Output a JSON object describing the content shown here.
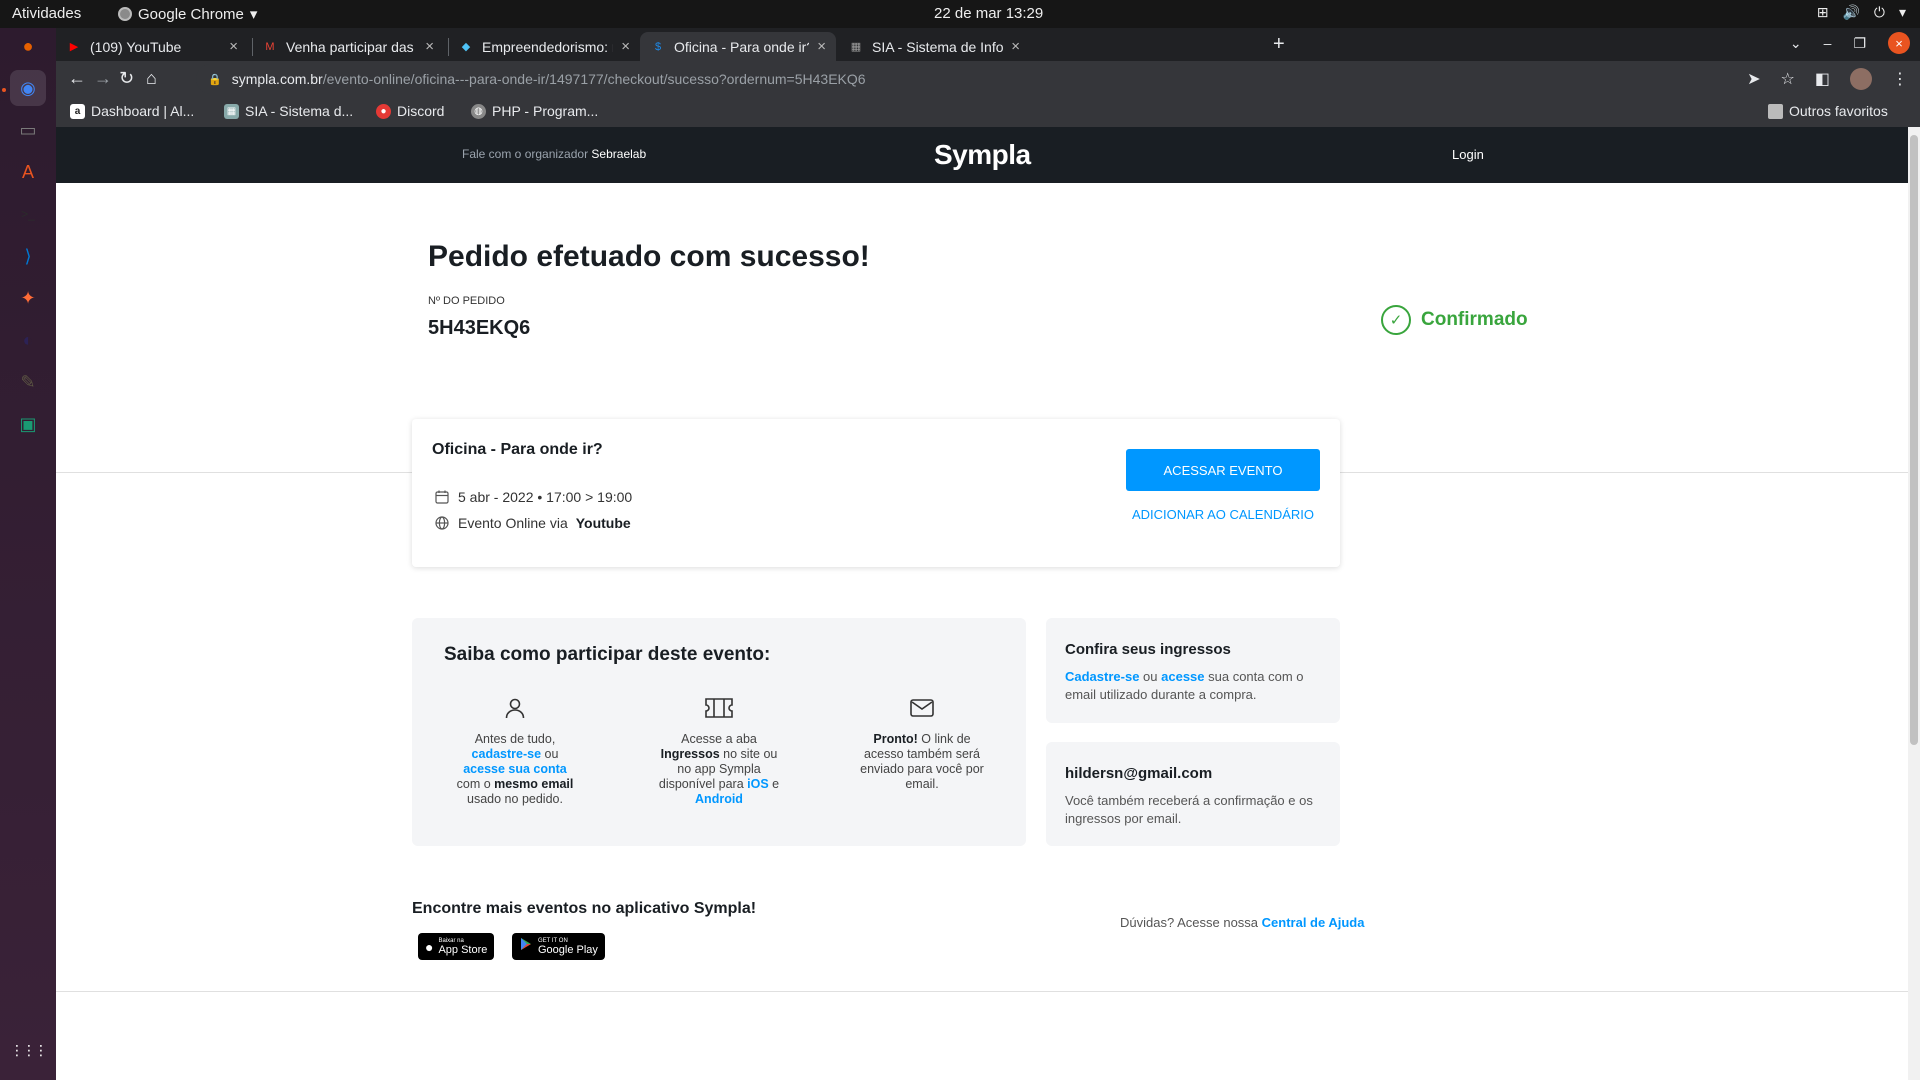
{
  "os": {
    "activities": "Atividades",
    "app_name": "Google Chrome",
    "app_caret": "▾",
    "clock": "22 de mar  13:29",
    "tray_network": "⊞",
    "tray_volume": "🔊",
    "tray_power": "⏻",
    "tray_caret": "▾"
  },
  "dock": {
    "items": [
      {
        "name": "firefox",
        "glyph": "●",
        "color": "#e66000"
      },
      {
        "name": "chrome",
        "glyph": "◉",
        "color": "#4285f4"
      },
      {
        "name": "files",
        "glyph": "▭",
        "color": "#7a7a7a"
      },
      {
        "name": "software",
        "glyph": "A",
        "color": "#e95420"
      },
      {
        "name": "terminal",
        "glyph": ">_",
        "color": "#2b2b2b"
      },
      {
        "name": "vscode",
        "glyph": "⟩",
        "color": "#0078d4"
      },
      {
        "name": "postman",
        "glyph": "✦",
        "color": "#ff6c37"
      },
      {
        "name": "eclipse",
        "glyph": "◐",
        "color": "#2c2255"
      },
      {
        "name": "gimp",
        "glyph": "✎",
        "color": "#5c5543"
      },
      {
        "name": "android",
        "glyph": "▣",
        "color": "#1a9b73"
      }
    ],
    "apps_grid": "⋮⋮⋮"
  },
  "tabs": [
    {
      "title": "(109) YouTube",
      "icon": "▶",
      "icon_color": "#ff0000",
      "active": false
    },
    {
      "title": "Venha participar das Ofic",
      "icon": "M",
      "icon_color": "#ea4335",
      "active": false
    },
    {
      "title": "Empreendedorismo: meu",
      "icon": "◆",
      "icon_color": "#4fc3f7",
      "active": false
    },
    {
      "title": "Oficina - Para onde ir?",
      "icon": "$",
      "icon_color": "#1e88e5",
      "active": true
    },
    {
      "title": "SIA - Sistema de Informaç",
      "icon": "▦",
      "icon_color": "#9e9e9e",
      "active": false
    }
  ],
  "tab_close": "×",
  "new_tab": "+",
  "window_controls": {
    "dropdown": "⌄",
    "minimize": "–",
    "restore": "❐",
    "close": "×"
  },
  "toolbar": {
    "back": "←",
    "forward": "→",
    "reload": "↻",
    "home": "⌂",
    "lock": "🔒",
    "url_host": "sympla.com.br",
    "url_path": "/evento-online/oficina---para-onde-ir/1497177/checkout/sucesso?ordernum=5H43EKQ6",
    "send": "➤",
    "star": "☆",
    "sidepanel": "◧"
  },
  "bookmarks": [
    {
      "label": "Dashboard | Al...",
      "icon": "a",
      "color": "#222"
    },
    {
      "label": "SIA - Sistema d...",
      "icon": "▦",
      "color": "#8aa"
    },
    {
      "label": "Discord",
      "icon": "●",
      "color": "#e53935"
    },
    {
      "label": "PHP - Program...",
      "icon": "◍",
      "color": "#888"
    }
  ],
  "other_bookmarks": "Outros favoritos",
  "site": {
    "org_prefix": "Fale com o organizador",
    "org_name": "Sebraelab",
    "logo": "Sympla",
    "login": "Login"
  },
  "order": {
    "heading": "Pedido efetuado com sucesso!",
    "number_label": "Nº DO PEDIDO",
    "number": "5H43EKQ6",
    "status": "Confirmado",
    "status_color": "#39a53d"
  },
  "event": {
    "title": "Oficina - Para onde ir?",
    "date": "5 abr - 2022 • 17:00 > 19:00",
    "location_prefix": "Evento Online via",
    "location_platform": "Youtube",
    "access_button": "ACESSAR EVENTO",
    "calendar_link": "ADICIONAR AO CALENDÁRIO",
    "accent": "#0097ff"
  },
  "how": {
    "title": "Saiba como participar deste evento:",
    "step1": {
      "t1": "Antes de tudo,",
      "l1": "cadastre-se",
      "t2": " ou",
      "l2": "acesse sua conta",
      "t3": "com o ",
      "b1": "mesmo email",
      "t4": "usado no pedido."
    },
    "step2": {
      "t1": "Acesse a aba",
      "b1": "Ingressos",
      "t2": " no site ou no app Sympla disponível para ",
      "l1": "iOS",
      "t3": " e",
      "l2": "Android"
    },
    "step3": {
      "b1": "Pronto!",
      "t1": " O link de acesso também será enviado para você por email."
    }
  },
  "tickets": {
    "title": "Confira seus ingressos",
    "l1": "Cadastre-se",
    "t1": " ou ",
    "l2": "acesse",
    "t2": " sua conta com o email utilizado durante a compra."
  },
  "email_card": {
    "email": "hildersn@gmail.com",
    "text": "Você também receberá a confirmação e os ingressos por email."
  },
  "apps": {
    "title": "Encontre mais eventos no aplicativo Sympla!",
    "appstore_small": "Baixar na",
    "appstore_big": "App Store",
    "gplay_small": "GET IT ON",
    "gplay_big": "Google Play"
  },
  "help": {
    "prefix": "Dúvidas? Acesse nossa ",
    "link": "Central de Ajuda"
  }
}
